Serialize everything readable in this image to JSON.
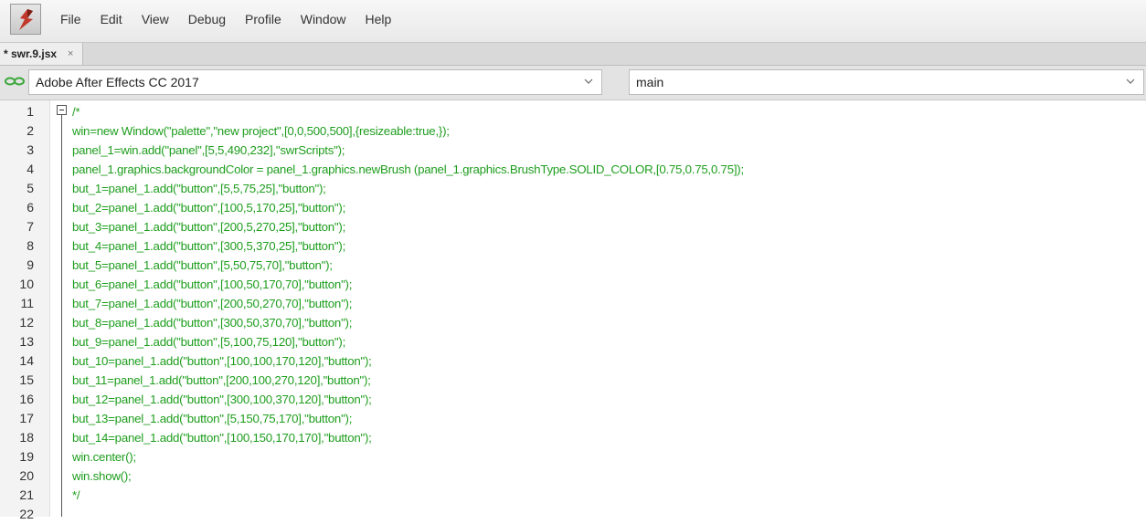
{
  "menu": {
    "items": [
      "File",
      "Edit",
      "View",
      "Debug",
      "Profile",
      "Window",
      "Help"
    ]
  },
  "tab": {
    "label": "* swr.9.jsx",
    "close": "×"
  },
  "target": {
    "application": "Adobe After Effects CC 2017",
    "engine": "main"
  },
  "colors": {
    "code_comment": "#1e9e1e",
    "app_icon_red": "#c0392b"
  },
  "editor": {
    "lines": [
      {
        "n": "1",
        "text": "/*"
      },
      {
        "n": "2",
        "text": "win=new Window(\"palette\",\"new project\",[0,0,500,500],{resizeable:true,});"
      },
      {
        "n": "3",
        "text": "panel_1=win.add(\"panel\",[5,5,490,232],\"swrScripts\");"
      },
      {
        "n": "4",
        "text": "panel_1.graphics.backgroundColor = panel_1.graphics.newBrush (panel_1.graphics.BrushType.SOLID_COLOR,[0.75,0.75,0.75]);"
      },
      {
        "n": "5",
        "text": "but_1=panel_1.add(\"button\",[5,5,75,25],\"button\");"
      },
      {
        "n": "6",
        "text": "but_2=panel_1.add(\"button\",[100,5,170,25],\"button\");"
      },
      {
        "n": "7",
        "text": "but_3=panel_1.add(\"button\",[200,5,270,25],\"button\");"
      },
      {
        "n": "8",
        "text": "but_4=panel_1.add(\"button\",[300,5,370,25],\"button\");"
      },
      {
        "n": "9",
        "text": "but_5=panel_1.add(\"button\",[5,50,75,70],\"button\");"
      },
      {
        "n": "10",
        "text": "but_6=panel_1.add(\"button\",[100,50,170,70],\"button\");"
      },
      {
        "n": "11",
        "text": "but_7=panel_1.add(\"button\",[200,50,270,70],\"button\");"
      },
      {
        "n": "12",
        "text": "but_8=panel_1.add(\"button\",[300,50,370,70],\"button\");"
      },
      {
        "n": "13",
        "text": "but_9=panel_1.add(\"button\",[5,100,75,120],\"button\");"
      },
      {
        "n": "14",
        "text": "but_10=panel_1.add(\"button\",[100,100,170,120],\"button\");"
      },
      {
        "n": "15",
        "text": "but_11=panel_1.add(\"button\",[200,100,270,120],\"button\");"
      },
      {
        "n": "16",
        "text": "but_12=panel_1.add(\"button\",[300,100,370,120],\"button\");"
      },
      {
        "n": "17",
        "text": "but_13=panel_1.add(\"button\",[5,150,75,170],\"button\");"
      },
      {
        "n": "18",
        "text": "but_14=panel_1.add(\"button\",[100,150,170,170],\"button\");"
      },
      {
        "n": "19",
        "text": "win.center();"
      },
      {
        "n": "20",
        "text": "win.show();"
      },
      {
        "n": "21",
        "text": "*/"
      },
      {
        "n": "22",
        "text": ""
      }
    ]
  }
}
